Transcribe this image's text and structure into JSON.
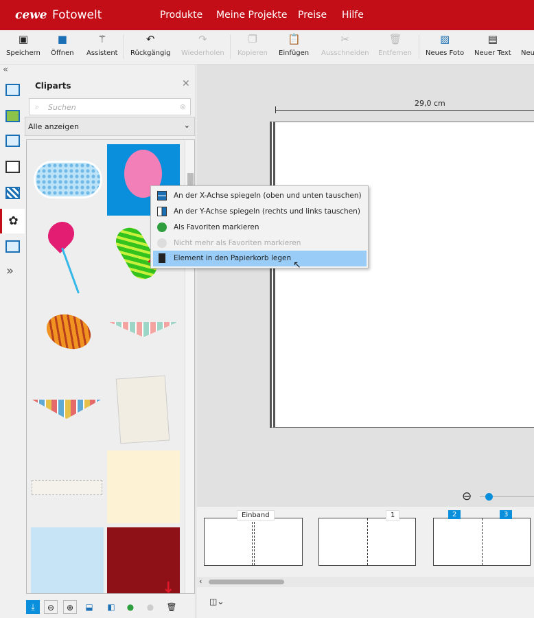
{
  "header": {
    "logo": "cewe",
    "brand": "Fotowelt",
    "nav": [
      "Produkte",
      "Meine Projekte",
      "Preise",
      "Hilfe"
    ]
  },
  "toolbar": [
    {
      "label": "Speichern",
      "icon": "save-icon",
      "enabled": true
    },
    {
      "label": "Öffnen",
      "icon": "open-icon",
      "enabled": true
    },
    {
      "label": "Assistent",
      "icon": "wand-icon",
      "enabled": true
    },
    {
      "label": "Rückgängig",
      "icon": "undo-icon",
      "enabled": true
    },
    {
      "label": "Wiederholen",
      "icon": "redo-icon",
      "enabled": false
    },
    {
      "label": "Kopieren",
      "icon": "copy-icon",
      "enabled": false
    },
    {
      "label": "Einfügen",
      "icon": "paste-icon",
      "enabled": true
    },
    {
      "label": "Ausschneiden",
      "icon": "scissors-icon",
      "enabled": false
    },
    {
      "label": "Entfernen",
      "icon": "trash-icon",
      "enabled": false
    },
    {
      "label": "Neues Foto",
      "icon": "new-photo-icon",
      "enabled": true
    },
    {
      "label": "Neuer Text",
      "icon": "new-text-icon",
      "enabled": true
    },
    {
      "label": "Neu",
      "icon": "new-icon",
      "enabled": true
    }
  ],
  "panel": {
    "title": "Cliparts",
    "search_placeholder": "Suchen",
    "filter": "Alle anzeigen"
  },
  "canvas": {
    "ruler_label": "29,0 cm",
    "zoom_percent": 5
  },
  "context_menu": [
    {
      "label": "An der X-Achse spiegeln (oben und unten tauschen)",
      "enabled": true
    },
    {
      "label": "An der Y-Achse spiegeln (rechts und links tauschen)",
      "enabled": true
    },
    {
      "label": "Als Favoriten markieren",
      "enabled": true
    },
    {
      "label": "Nicht mehr als Favoriten markieren",
      "enabled": false
    },
    {
      "label": "Element in den Papierkorb legen",
      "enabled": true,
      "highlighted": true
    }
  ],
  "filmstrip": {
    "labels": [
      "Einband",
      "1",
      "2",
      "3"
    ]
  },
  "colors": {
    "brand": "#c30d17",
    "accent": "#0a8fdc",
    "highlight": "#99cdf7"
  }
}
